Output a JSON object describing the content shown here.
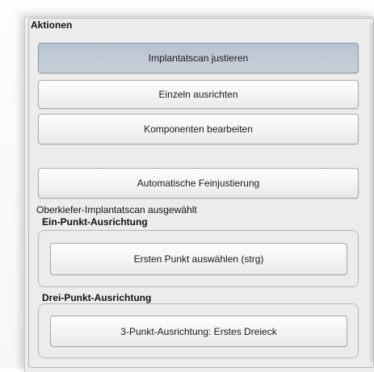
{
  "panel": {
    "title": "Aktionen"
  },
  "buttons": {
    "implant_scan_adjust": "Implantatscan justieren",
    "align_single": "Einzeln ausrichten",
    "edit_components": "Komponenten bearbeiten",
    "auto_fine_adjust": "Automatische Feinjustierung"
  },
  "status": {
    "selected_scan": "Oberkiefer-Implantatscan ausgewählt"
  },
  "one_point": {
    "title": "Ein-Punkt-Ausrichtung",
    "button": "Ersten Punkt auswählen (strg)"
  },
  "three_point": {
    "title": "Drei-Punkt-Ausrichtung",
    "button": "3-Punkt-Ausrichtung: Erstes Dreieck"
  }
}
